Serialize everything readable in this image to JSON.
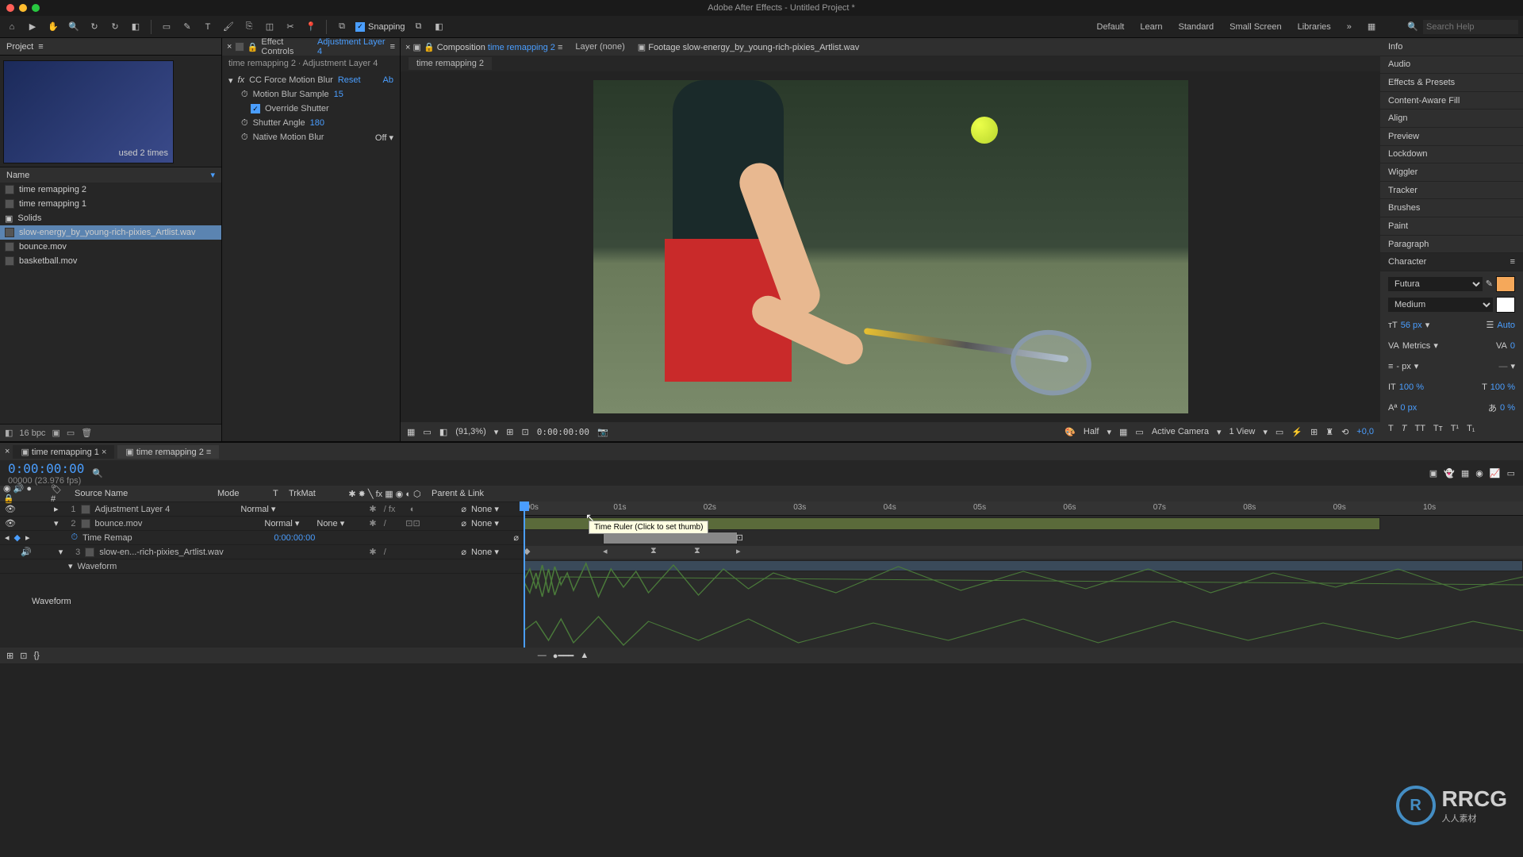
{
  "titlebar": {
    "title": "Adobe After Effects - Untitled Project *"
  },
  "toolbar": {
    "snapping_label": "Snapping",
    "workspaces": [
      "Default",
      "Learn",
      "Standard",
      "Small Screen",
      "Libraries"
    ],
    "search_placeholder": "Search Help"
  },
  "project": {
    "tab": "Project",
    "used_text": "used 2 times",
    "col_name": "Name",
    "items": [
      {
        "name": "time remapping 2",
        "kind": "comp"
      },
      {
        "name": "time remapping 1",
        "kind": "comp"
      },
      {
        "name": "Solids",
        "kind": "folder"
      },
      {
        "name": "slow-energy_by_young-rich-pixies_Artlist.wav",
        "kind": "audio",
        "selected": true
      },
      {
        "name": "bounce.mov",
        "kind": "video"
      },
      {
        "name": "basketball.mov",
        "kind": "video"
      }
    ],
    "bpc": "16 bpc"
  },
  "effect_controls": {
    "tab_label": "Effect Controls",
    "tab_link": "Adjustment Layer 4",
    "crumb": "time remapping 2 ∙ Adjustment Layer 4",
    "effect_name": "CC Force Motion Blur",
    "reset": "Reset",
    "about": "Ab",
    "rows": {
      "motion_blur_sample_label": "Motion Blur Sample",
      "motion_blur_sample_val": "15",
      "override_shutter_label": "Override Shutter",
      "shutter_angle_label": "Shutter Angle",
      "shutter_angle_val": "180",
      "native_motion_blur_label": "Native Motion Blur",
      "native_motion_blur_val": "Off"
    }
  },
  "viewer": {
    "tabs": {
      "comp_label": "Composition",
      "comp_link": "time remapping 2",
      "layer_label": "Layer (none)",
      "footage_label": "Footage slow-energy_by_young-rich-pixies_Artlist.wav"
    },
    "subtab": "time remapping 2",
    "bottom": {
      "magnification": "(91,3%)",
      "timecode": "0:00:00:00",
      "resolution": "Half",
      "active_camera": "Active Camera",
      "view_count": "1 View",
      "exposure": "+0,0"
    }
  },
  "right_panels": {
    "items": [
      "Info",
      "Audio",
      "Effects & Presets",
      "Content-Aware Fill",
      "Align",
      "Preview",
      "Lockdown",
      "Wiggler",
      "Tracker",
      "Brushes",
      "Paint",
      "Paragraph"
    ],
    "character": {
      "title": "Character",
      "font": "Futura",
      "weight": "Medium",
      "size": "56 px",
      "leading": "Auto",
      "kerning": "Metrics",
      "tracking": "0",
      "stroke": "- px",
      "vscale": "100 %",
      "hscale": "100 %",
      "baseline": "0 px",
      "tsume": "0 %"
    }
  },
  "timeline": {
    "tabs": [
      "time remapping 1",
      "time remapping 2"
    ],
    "active_tab": 1,
    "timecode": "0:00:00:00",
    "fps": "00000 (23.976 fps)",
    "tooltip": "Time Ruler (Click to set thumb)",
    "columns": {
      "source_name": "Source Name",
      "mode": "Mode",
      "t": "T",
      "trkmat": "TrkMat",
      "parent": "Parent & Link"
    },
    "ruler_ticks": [
      ":00s",
      "01s",
      "02s",
      "03s",
      "04s",
      "05s",
      "06s",
      "07s",
      "08s",
      "09s",
      "10s"
    ],
    "layers": [
      {
        "num": "1",
        "name": "Adjustment Layer 4",
        "mode": "Normal",
        "parent": "None"
      },
      {
        "num": "2",
        "name": "bounce.mov",
        "mode": "Normal",
        "trkmat": "None",
        "parent": "None"
      },
      {
        "sub": true,
        "name": "Time Remap",
        "value": "0:00:00:00"
      },
      {
        "num": "3",
        "name": "slow-en...-rich-pixies_Artlist.wav",
        "parent": "None"
      },
      {
        "sub": true,
        "name": "Waveform"
      }
    ],
    "waveform_label": "Waveform"
  },
  "icons": {
    "home": "⌂",
    "triangle": "▶",
    "hand": "✋",
    "zoom": "🔍",
    "orbit": "↻",
    "rect": "▭",
    "rounded": "◧",
    "pen": "✎",
    "text": "T",
    "brush": "🖌",
    "clone": "⎘",
    "eraser": "◫",
    "roto": "✂",
    "puppet": "📍",
    "snap_magnet": "⧉",
    "chevron": "»",
    "grid": "▦",
    "search": "🔍",
    "menu": "≡",
    "close": "×",
    "lock": "🔒",
    "folder": "▣",
    "eye": "👁",
    "spk": "🔊",
    "tri": "▸",
    "dd": "▾",
    "stopwatch": "⏱",
    "diamond": "◆"
  }
}
